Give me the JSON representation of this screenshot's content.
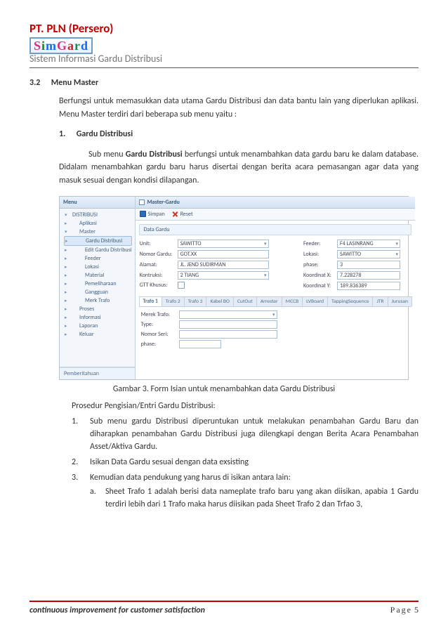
{
  "header": {
    "company": "PT. PLN (Persero)",
    "logo_text": "SimGard",
    "subtitle": "Sistem Informasi Gardu Distribusi"
  },
  "section": {
    "number": "3.2",
    "title": "Menu Master",
    "intro": "Berfungsi untuk memasukkan data utama Gardu Distribusi dan data bantu lain yang diperlukan aplikasi. Menu Master terdiri dari beberapa sub menu yaitu :",
    "item_num": "1.",
    "item_title": "Gardu Distribusi",
    "item_para": "Sub menu Gardu Distribusi berfungsi untuk menambahkan data gardu baru ke dalam database. Didalam menambahkan gardu baru harus disertai dengan berita acara pemasangan agar data yang masuk sesuai dengan kondisi dilapangan."
  },
  "screenshot": {
    "menu_title": "Menu",
    "tree": {
      "distribusi": "DISTRIBUSI",
      "aplikasi": "Aplikasi",
      "master": "Master",
      "gardu": "Gardu Distribusi",
      "edit_gardu": "Edit Gardu Distribusi",
      "feeder": "Feeder",
      "lokasi": "Lokasi",
      "material": "Material",
      "pemeliharaan": "Pemeliharaan",
      "gangguan": "Gangguan",
      "merk": "Merk Trafo",
      "proses": "Proses",
      "informasi": "Informasi",
      "laporan": "Laporan",
      "keluar": "Keluar"
    },
    "bottom_item": "Pemberitahuan",
    "tab_title": "Master-Gardu",
    "toolbar": {
      "save": "Simpan",
      "reset": "Reset"
    },
    "section_hdr": "Data Gardu",
    "form": {
      "unit_lbl": "Unit:",
      "unit_val": "SAWITTO",
      "nomor_lbl": "Nomor Gardu:",
      "nomor_val": "GOT.XX",
      "alamat_lbl": "Alamat:",
      "alamat_val": "JL. JEND SUDIRMAN",
      "konstruksi_lbl": "Kontruksi:",
      "konstruksi_val": "2 TIANG",
      "gtt_lbl": "GTT Khusus:",
      "feeder_lbl": "Feeder:",
      "feeder_val": "F4 LASINRANG",
      "lokasi_lbl": "Lokasi:",
      "lokasi_val": "SAWITTO",
      "phase_lbl": "phase:",
      "phase_val": "3",
      "kx_lbl": "Koordinat X:",
      "kx_val": "7.228278",
      "ky_lbl": "Koordinat Y:",
      "ky_val": "189.836389"
    },
    "tabs": [
      "Trafo 1",
      "Trafo 2",
      "Trafo 3",
      "Kabel BO",
      "CutOut",
      "Arrester",
      "MCCB",
      "LVBoard",
      "TappingSequence",
      "JTR",
      "Jurusan"
    ],
    "subform": {
      "merk_lbl": "Merek Trafo:",
      "type_lbl": "Type:",
      "noseri_lbl": "Nomor Seri:",
      "phase_lbl": "phase:"
    }
  },
  "caption": "Gambar 3. Form Isian untuk menambahkan data Gardu Distribusi",
  "procedure": {
    "title": "Prosedur Pengisian/Entri Gardu Distribusi:",
    "items": [
      {
        "n": "1.",
        "t": "Sub menu gardu Distribusi diperuntukan untuk melakukan penambahan Gardu Baru dan diharapkan penambahan Gardu Distribusi juga dilengkapi dengan Berita Acara Penambahan Asset/Aktiva Gardu."
      },
      {
        "n": "2.",
        "t": "Isikan Data Gardu sesuai dengan data exsisting"
      },
      {
        "n": "3.",
        "t": "Kemudian data pendukung yang harus di isikan antara lain:",
        "sub": [
          {
            "n": "a.",
            "t": "Sheet Trafo 1 adalah berisi data nameplate trafo baru yang akan diisikan, apabia 1 Gardu terdiri lebih dari 1 Trafo maka harus diisikan pada Sheet Trafo 2 dan Trfao 3,"
          }
        ]
      }
    ]
  },
  "footer": {
    "slogan": "continuous improvement for  customer satisfaction",
    "page_label": "Page",
    "page_num": "5"
  }
}
